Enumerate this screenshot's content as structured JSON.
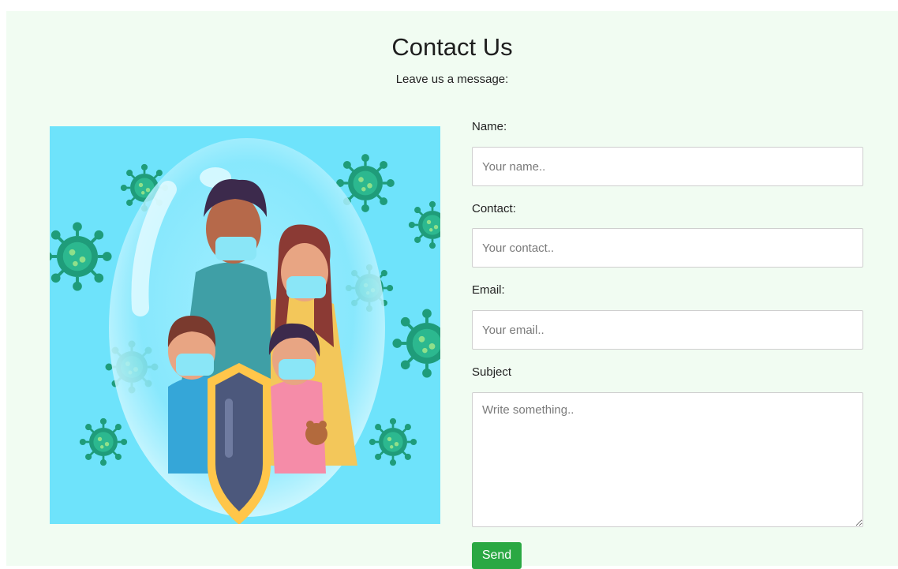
{
  "header": {
    "title": "Contact Us",
    "subtitle": "Leave us a message:"
  },
  "illustration": {
    "icon": "family-masks-shield-illustration",
    "background_color": "#6ee3fb"
  },
  "form": {
    "name": {
      "label": "Name:",
      "placeholder": "Your name..",
      "value": ""
    },
    "contact": {
      "label": "Contact:",
      "placeholder": "Your contact..",
      "value": ""
    },
    "email": {
      "label": "Email:",
      "placeholder": "Your email..",
      "value": ""
    },
    "subject": {
      "label": "Subject",
      "placeholder": "Write something..",
      "value": ""
    },
    "send_label": "Send"
  },
  "colors": {
    "page_background": "#f1fcf2",
    "button": "#2aa843",
    "input_border": "#cfcfcf"
  }
}
